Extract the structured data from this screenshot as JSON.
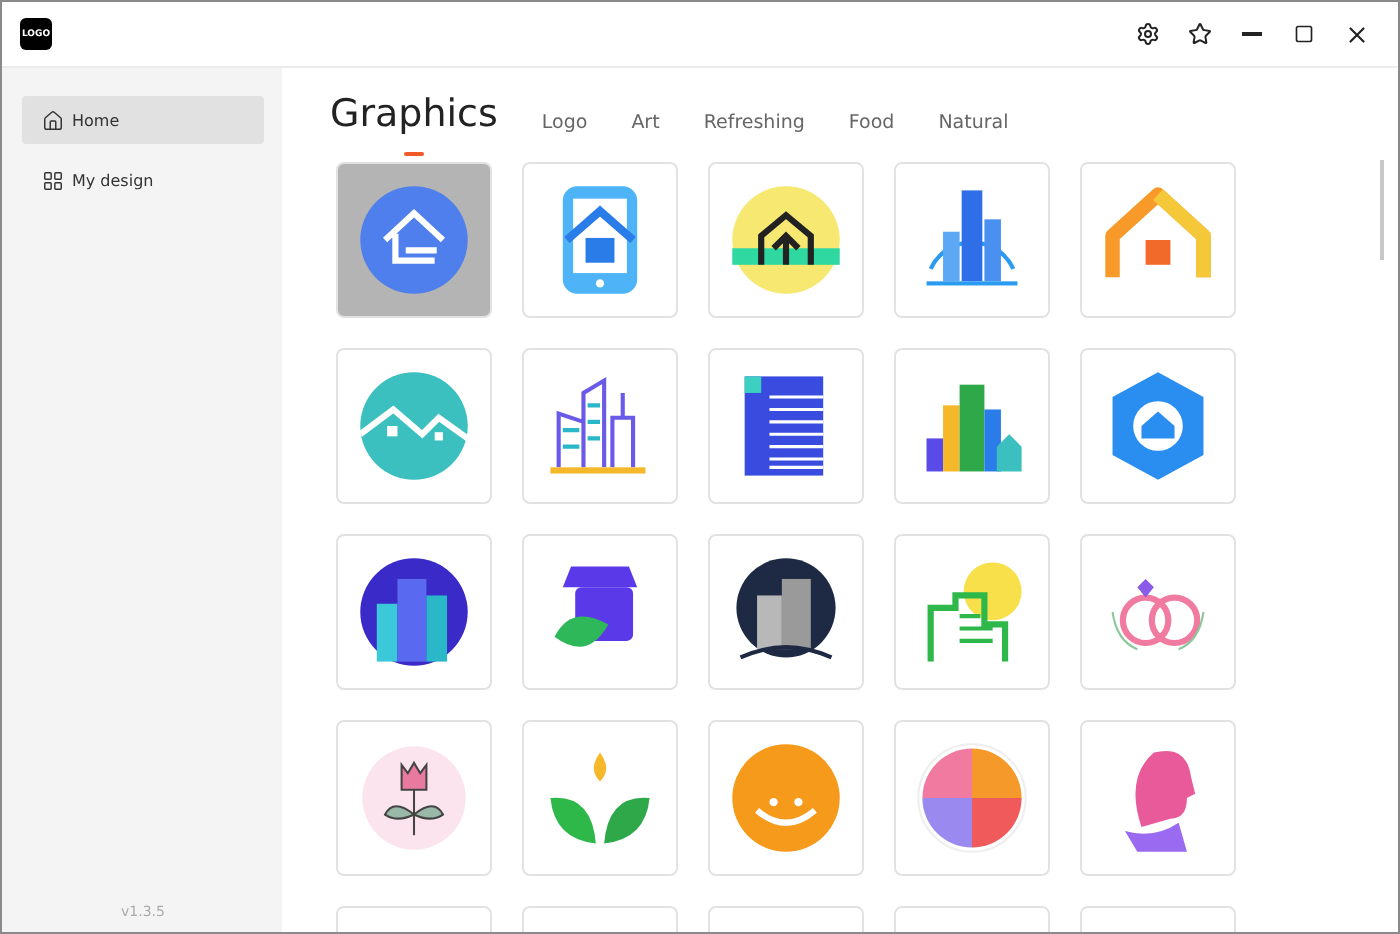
{
  "app": {
    "logo": "LOGO"
  },
  "sidebar": {
    "items": [
      {
        "label": "Home",
        "selected": true
      },
      {
        "label": "My design",
        "selected": false
      }
    ],
    "version": "v1.3.5"
  },
  "tabs": [
    {
      "label": "Graphics",
      "selected": true
    },
    {
      "label": "Logo",
      "selected": false
    },
    {
      "label": "Art",
      "selected": false
    },
    {
      "label": "Refreshing",
      "selected": false
    },
    {
      "label": "Food",
      "selected": false
    },
    {
      "label": "Natural",
      "selected": false
    }
  ],
  "tiles": [
    {
      "selected": true
    },
    {
      "selected": false
    },
    {
      "selected": false
    },
    {
      "selected": false
    },
    {
      "selected": false
    },
    {
      "selected": false
    },
    {
      "selected": false
    },
    {
      "selected": false
    },
    {
      "selected": false
    },
    {
      "selected": false
    },
    {
      "selected": false
    },
    {
      "selected": false
    },
    {
      "selected": false
    },
    {
      "selected": false
    },
    {
      "selected": false
    },
    {
      "selected": false
    },
    {
      "selected": false
    },
    {
      "selected": false
    },
    {
      "selected": false
    },
    {
      "selected": false
    },
    {
      "selected": false
    },
    {
      "selected": false
    },
    {
      "selected": false
    },
    {
      "selected": false
    },
    {
      "selected": false
    }
  ]
}
